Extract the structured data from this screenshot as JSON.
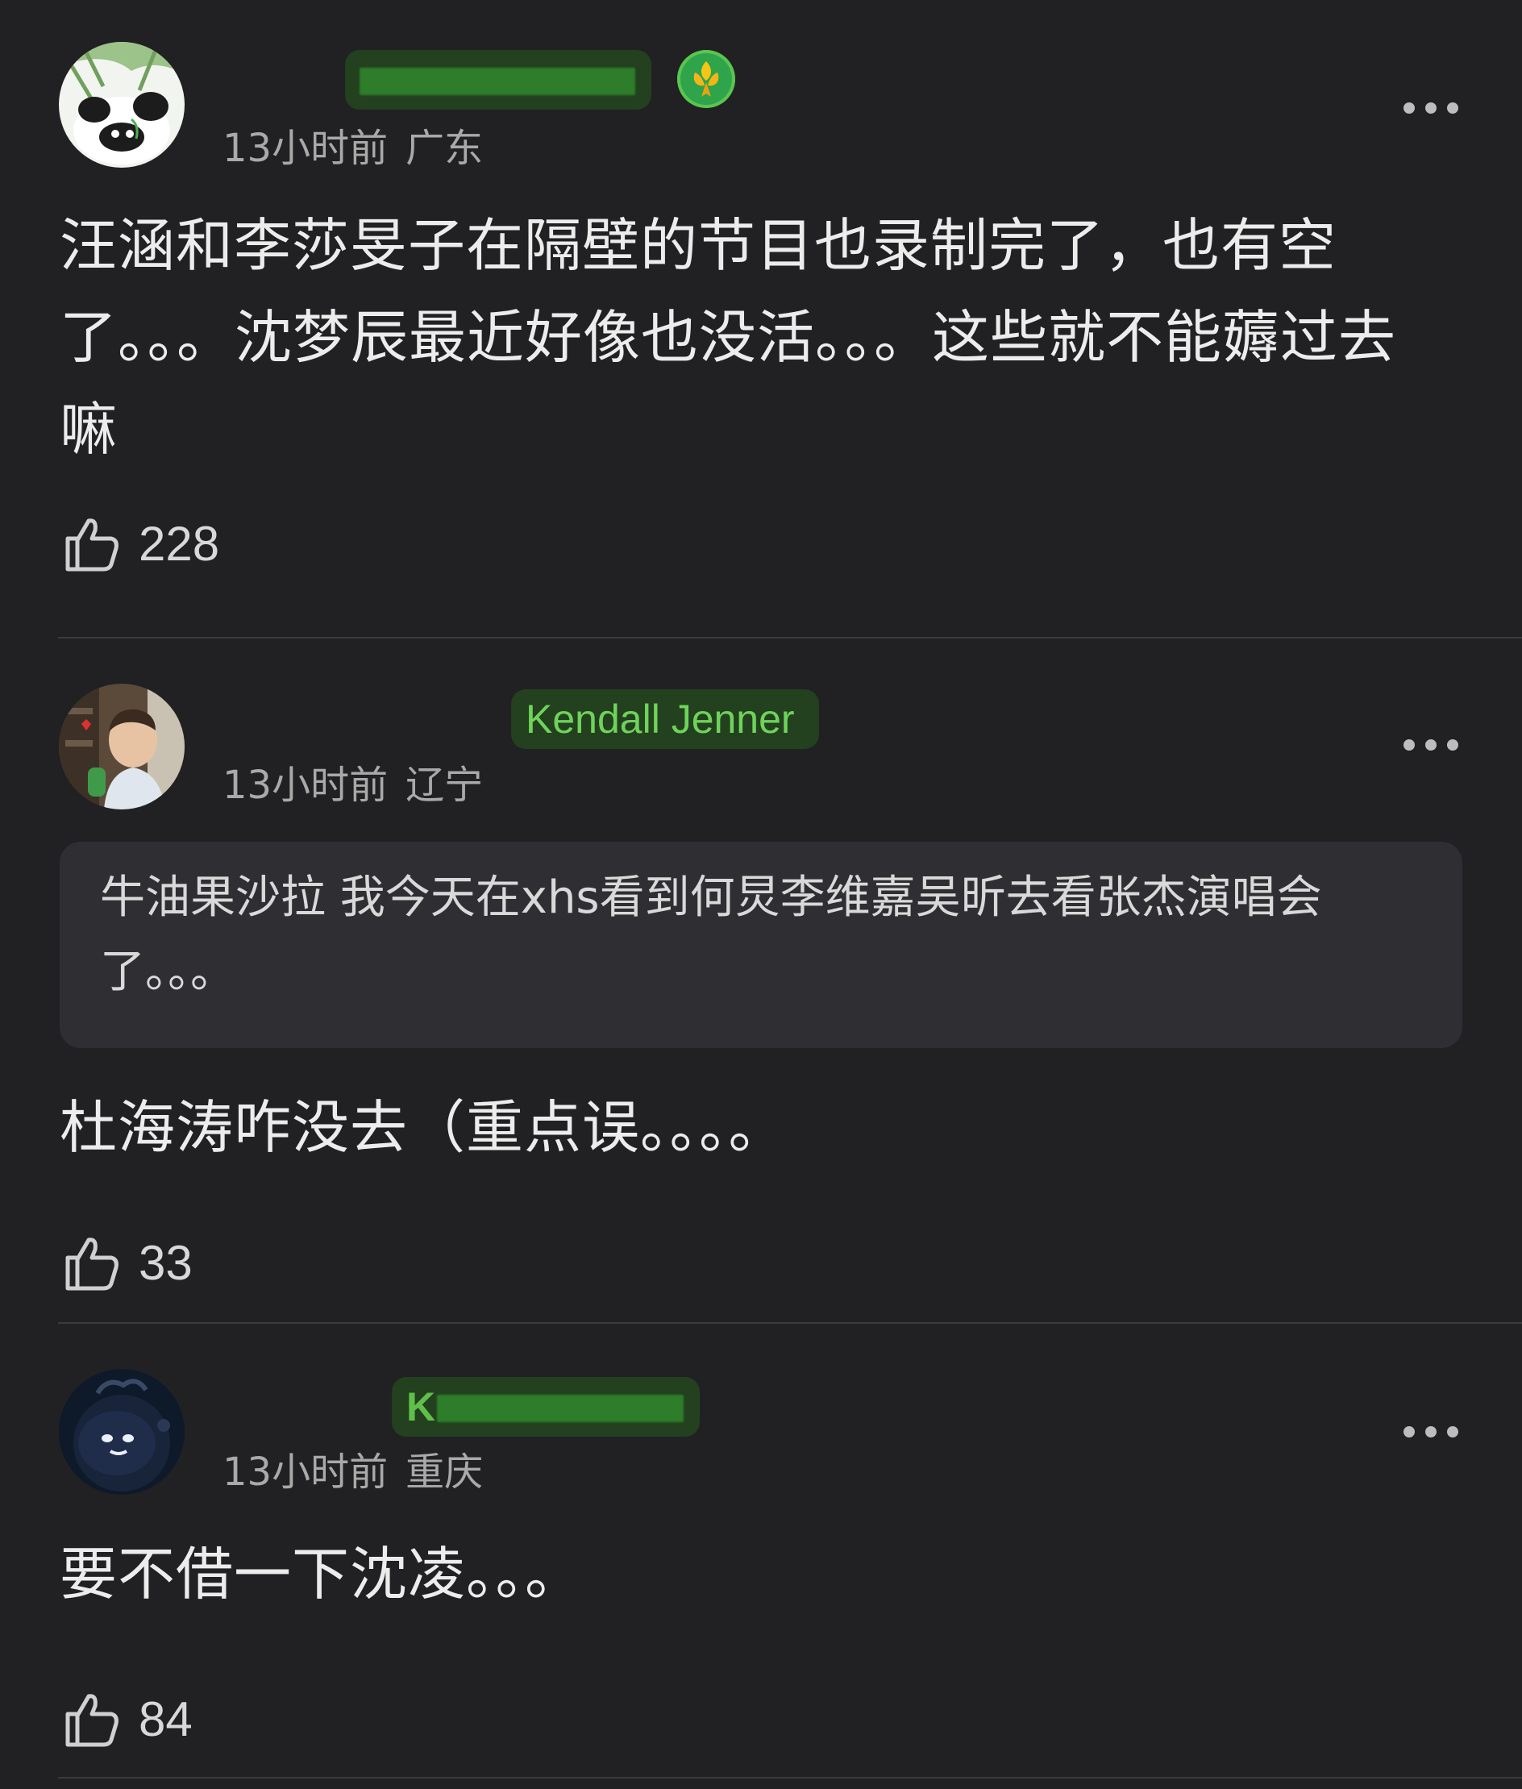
{
  "comments": [
    {
      "username": "",
      "time": "13小时前",
      "location": "广东",
      "text": "汪涵和李莎旻子在隔壁的节目也录制完了，也有空了。。。沈梦辰最近好像也没活。。。这些就不能薅过去嘛",
      "likes": "228",
      "avatar_icon": "panda-avatar",
      "badge_icon": "flower-level-badge"
    },
    {
      "username": "Kendall Jenner",
      "time": "13小时前",
      "location": "辽宁",
      "quote": "牛油果沙拉 我今天在xhs看到何炅李维嘉吴昕去看张杰演唱会了。。。",
      "text": "杜海涛咋没去（重点误。。。。",
      "likes": "33",
      "avatar_icon": "child-photo-avatar"
    },
    {
      "username": "K",
      "time": "13小时前",
      "location": "重庆",
      "text": "要不借一下沈凌。。。",
      "likes": "84",
      "avatar_icon": "dark-creature-avatar"
    }
  ],
  "colors": {
    "background": "#212123",
    "username_green": "#6ed35a",
    "meta_gray": "#a9a9aa",
    "quote_background": "#2f2f33"
  }
}
